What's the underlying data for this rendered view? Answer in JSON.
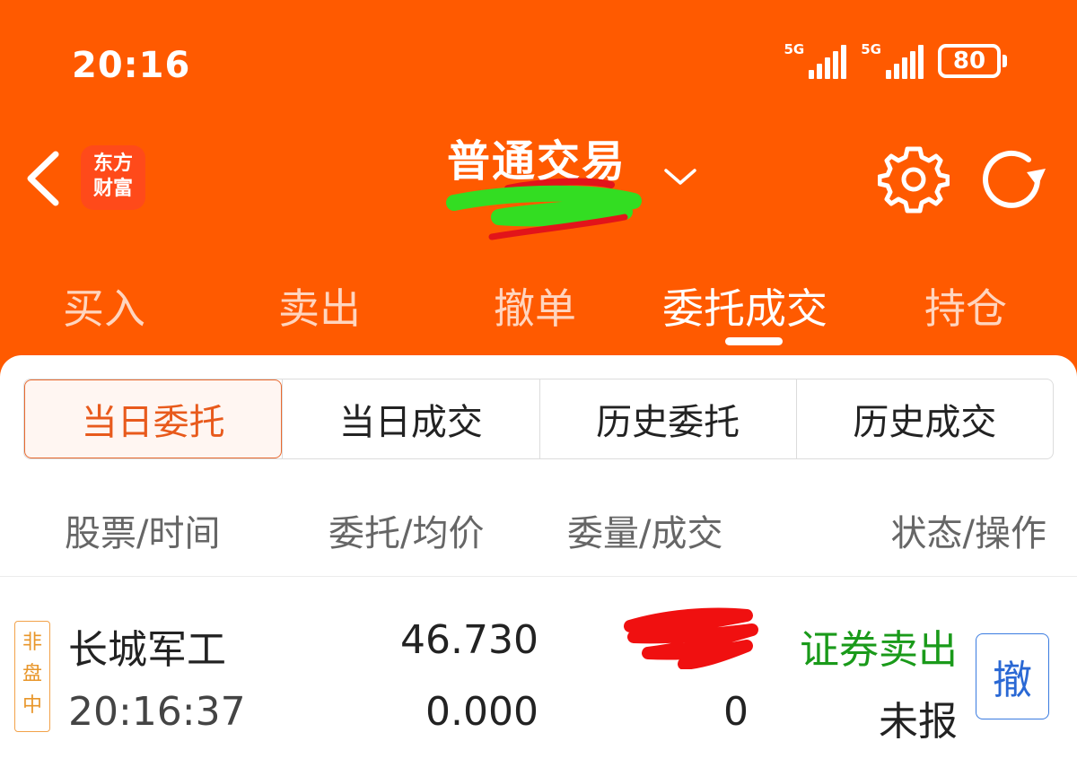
{
  "status_bar": {
    "time": "20:16",
    "signal1_label": "5G",
    "signal2_label": "5G",
    "battery": "80"
  },
  "header": {
    "logo_line1": "东方",
    "logo_line2": "财富",
    "title": "普通交易"
  },
  "tabs": [
    {
      "label": "买入",
      "active": false
    },
    {
      "label": "卖出",
      "active": false
    },
    {
      "label": "撤单",
      "active": false
    },
    {
      "label": "委托成交",
      "active": true
    },
    {
      "label": "持仓",
      "active": false
    }
  ],
  "segments": [
    {
      "label": "当日委托",
      "active": true
    },
    {
      "label": "当日成交",
      "active": false
    },
    {
      "label": "历史委托",
      "active": false
    },
    {
      "label": "历史成交",
      "active": false
    }
  ],
  "columns": [
    "股票/时间",
    "委托/均价",
    "委量/成交",
    "状态/操作"
  ],
  "orders": [
    {
      "badge": "非盘中",
      "name": "长城军工",
      "time": "20:16:37",
      "price": "46.730",
      "avg_price": "0.000",
      "filled_qty": "0",
      "direction": "证券卖出",
      "status": "未报",
      "cancel_label": "撤"
    }
  ],
  "colors": {
    "brand": "#ff5a00",
    "sell_text": "#1a9a1a",
    "cancel_blue": "#2a68d4",
    "badge_orange": "#e8962a"
  }
}
